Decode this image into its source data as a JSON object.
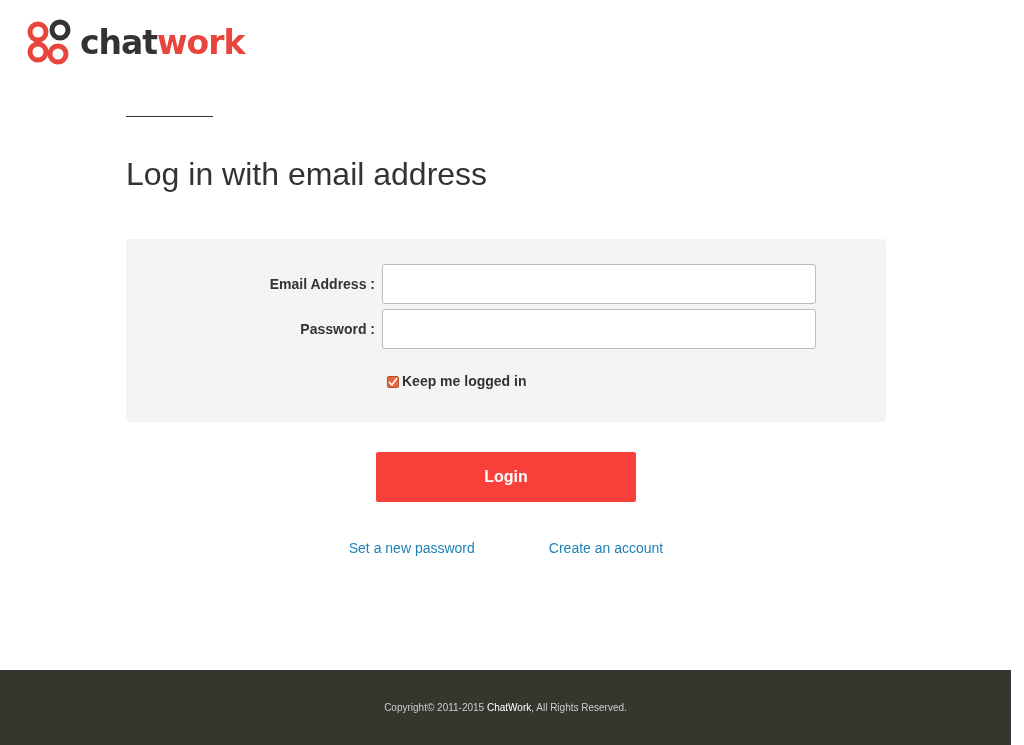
{
  "logo": {
    "dark_part": "chat",
    "accent_part": "work"
  },
  "heading": "Log in with email address",
  "form": {
    "fields": [
      {
        "label": "Email Address :"
      },
      {
        "label": "Password :"
      }
    ],
    "remember": {
      "label": "Keep me logged in",
      "checked": true
    }
  },
  "login_button": "Login",
  "links": [
    "Set a new password",
    "Create an account"
  ],
  "footer": {
    "before": "Copyright© 2011-2015 ",
    "link": "ChatWork",
    "after": ", All Rights Reserved."
  }
}
